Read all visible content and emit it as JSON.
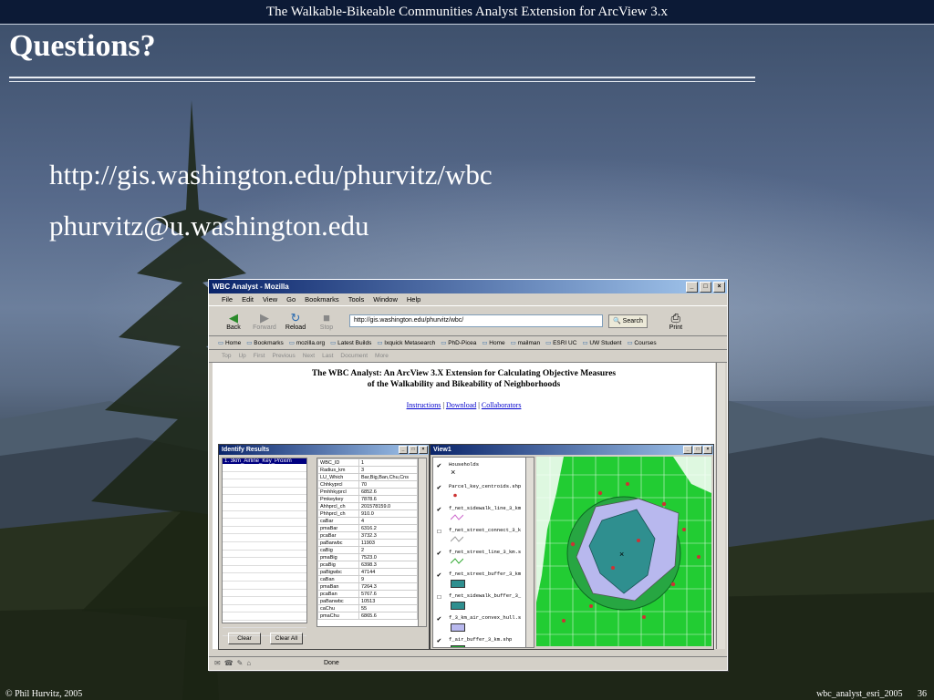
{
  "slide": {
    "header": "The Walkable-Bikeable Communities Analyst Extension for ArcView 3.x",
    "title": "Questions?",
    "bullets": [
      "http://gis.washington.edu/phurvitz/wbc",
      "phurvitz@u.washington.edu"
    ],
    "footer_left": "© Phil Hurvitz, 2005",
    "footer_file": "wbc_analyst_esri_2005",
    "footer_page": "36"
  },
  "browser": {
    "window_title": "WBC Analyst - Mozilla",
    "menu": [
      "File",
      "Edit",
      "View",
      "Go",
      "Bookmarks",
      "Tools",
      "Window",
      "Help"
    ],
    "nav_buttons": [
      {
        "label": "Back",
        "icon": "back-arrow-icon",
        "enabled": true
      },
      {
        "label": "Forward",
        "icon": "forward-arrow-icon",
        "enabled": false
      },
      {
        "label": "Reload",
        "icon": "reload-icon",
        "enabled": true
      },
      {
        "label": "Stop",
        "icon": "stop-icon",
        "enabled": false
      }
    ],
    "url": "http://gis.washington.edu/phurvitz/wbc/",
    "search_label": "Search",
    "print_label": "Print",
    "bookmarks": [
      "Home",
      "Bookmarks",
      "mozilla.org",
      "Latest Builds",
      "Ixquick Metasearch",
      "PhD-Picea",
      "Home",
      "mailman",
      "ESRI UC",
      "UW Student",
      "Courses"
    ],
    "site_nav": [
      "Top",
      "Up",
      "First",
      "Previous",
      "Next",
      "Last",
      "Document",
      "More"
    ],
    "status": "Done"
  },
  "page": {
    "heading_line1": "The WBC Analyst: An ArcView 3.X Extension for Calculating Objective Measures",
    "heading_line2": "of the Walkability and Bikeability of Neighborhoods",
    "links": [
      "Instructions",
      "Download",
      "Collaborators"
    ],
    "separator": "|"
  },
  "identify": {
    "title": "Identify Results",
    "selected_item": "1. 3km_Airline_Key_Proxim",
    "rows": [
      [
        "WBC_ID",
        "1"
      ],
      [
        "Radius_km",
        "3"
      ],
      [
        "LU_Which",
        "Bar,Big,Ban,Chu,Cns"
      ],
      [
        "Chhkyprcl",
        "70"
      ],
      [
        "Pmhhkyprcl",
        "6852.6"
      ],
      [
        "Pmkeykey",
        "7878.6"
      ],
      [
        "Ahhprcl_ch",
        "201578159.0"
      ],
      [
        "Phhprcl_ch",
        "910.0"
      ],
      [
        "caBar",
        "4"
      ],
      [
        "pmaBar",
        "6316.2"
      ],
      [
        "pcaBar",
        "3732.3"
      ],
      [
        "paBarwbc",
        "11903"
      ],
      [
        "caBig",
        "2"
      ],
      [
        "pmaBig",
        "7523.0"
      ],
      [
        "pcaBig",
        "6398.3"
      ],
      [
        "paBigwbc",
        "47144"
      ],
      [
        "caBan",
        "9"
      ],
      [
        "pmaBan",
        "7264.3"
      ],
      [
        "pcaBan",
        "5767.6"
      ],
      [
        "paBanwbc",
        "10513"
      ],
      [
        "caChu",
        "55"
      ],
      [
        "pmaChu",
        "6865.6"
      ]
    ],
    "clear_label": "Clear",
    "clear_all_label": "Clear All"
  },
  "view": {
    "title": "View1",
    "layers": [
      {
        "name": "Households",
        "checked": true,
        "symbol": "cross",
        "color": "#000000"
      },
      {
        "name": "Parcel_key_centroids.shp",
        "checked": true,
        "symbol": "dot",
        "color": "#cc3333"
      },
      {
        "name": "f_net_sidewalk_line_3_km",
        "checked": true,
        "symbol": "line",
        "color": "#cc66cc"
      },
      {
        "name": "f_net_street_connect_3_k",
        "checked": false,
        "symbol": "line",
        "color": "#999999"
      },
      {
        "name": "f_net_street_line_3_km.s",
        "checked": true,
        "symbol": "line",
        "color": "#33aa33"
      },
      {
        "name": "f_net_street_buffer_3_km",
        "checked": true,
        "symbol": "fill",
        "color": "#2f8f8f"
      },
      {
        "name": "f_net_sidewalk_buffer_3_",
        "checked": false,
        "symbol": "fill",
        "color": "#2f8f8f"
      },
      {
        "name": "f_3_km_air_convex_hull.s",
        "checked": true,
        "symbol": "fill",
        "color": "#b8b8ee"
      },
      {
        "name": "f_air_buffer_3_km.shp",
        "checked": true,
        "symbol": "fill",
        "color": "#22aa33"
      }
    ]
  }
}
